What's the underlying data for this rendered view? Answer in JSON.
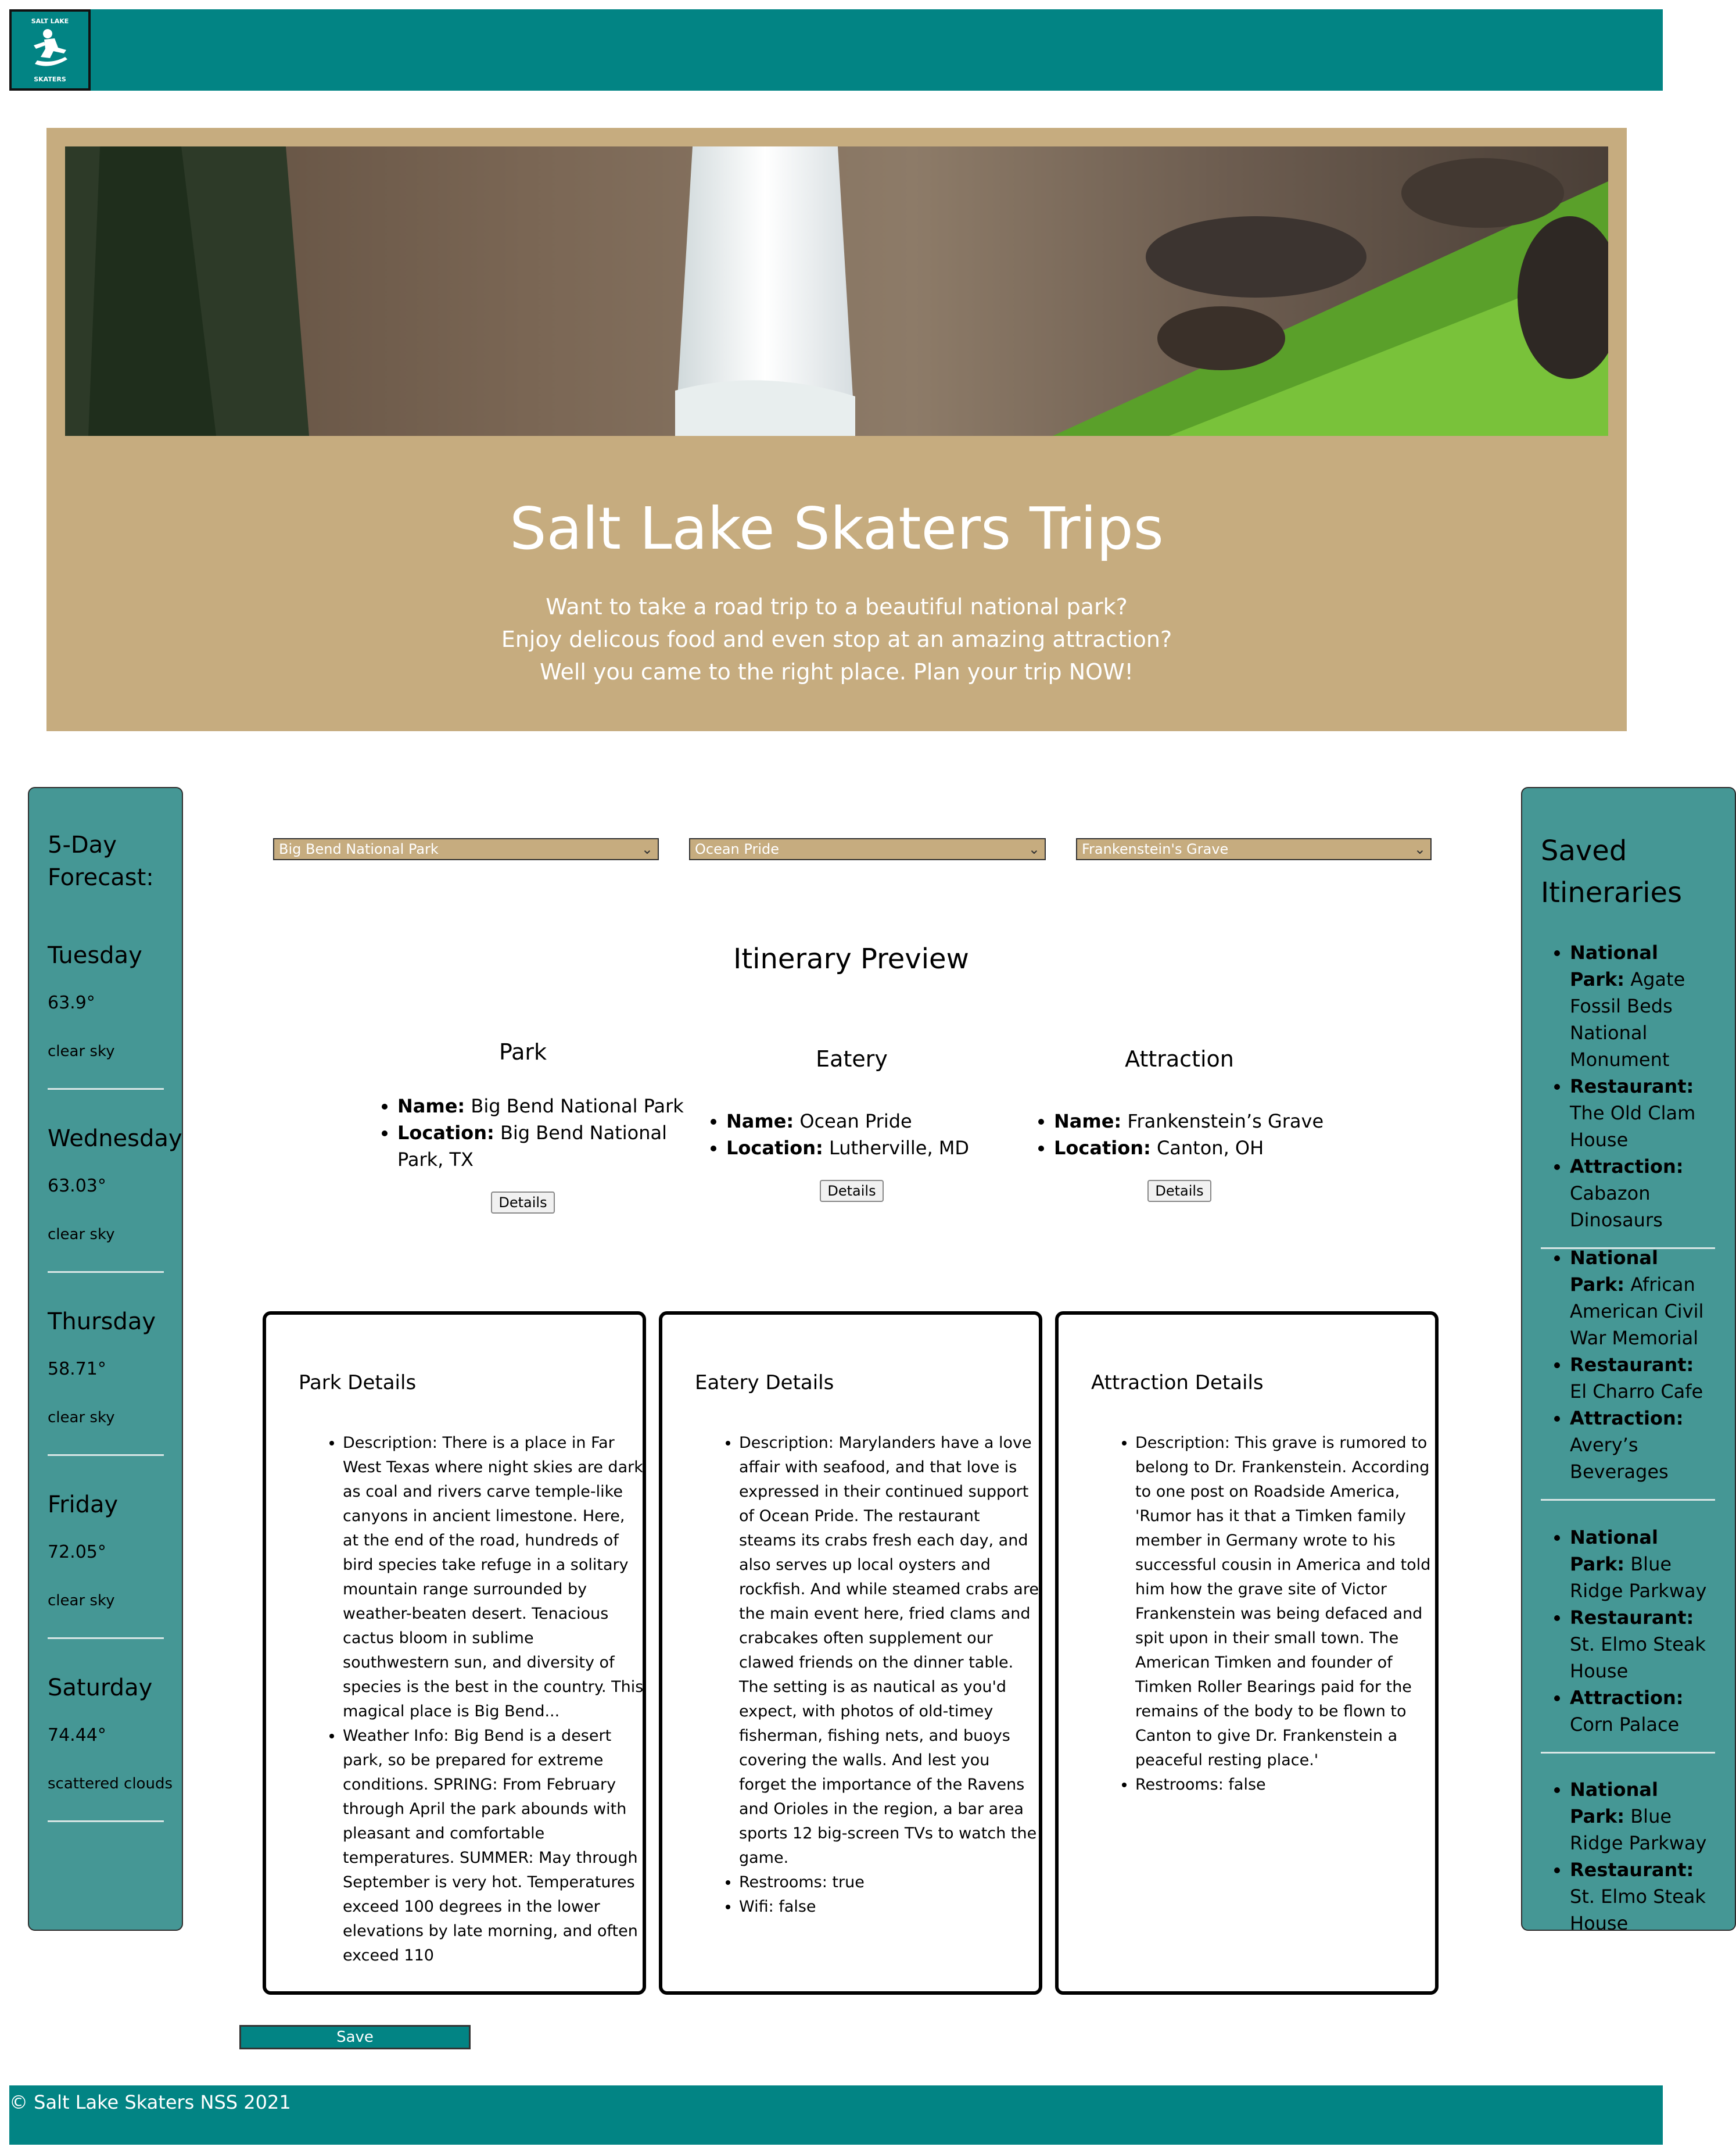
{
  "colors": {
    "header": "#028484",
    "hero_bg": "#c6ac7f",
    "sidebar": "#459795"
  },
  "logo": {
    "text_top": "SALT LAKE",
    "text_bottom": "SKATERS"
  },
  "hero": {
    "title": "Salt Lake Skaters Trips",
    "lines": [
      "Want to take a road trip to a beautiful national park?",
      "Enjoy delicous food and even stop at an amazing attraction?",
      "Well you came to the right place. Plan your trip NOW!"
    ]
  },
  "forecast": {
    "title_line1": "5-Day",
    "title_line2": "Forecast:",
    "days": [
      {
        "name": "Tuesday",
        "temp": "63.9°",
        "desc": "clear sky"
      },
      {
        "name": "Wednesday",
        "temp": "63.03°",
        "desc": "clear sky"
      },
      {
        "name": "Thursday",
        "temp": "58.71°",
        "desc": "clear sky"
      },
      {
        "name": "Friday",
        "temp": "72.05°",
        "desc": "clear sky"
      },
      {
        "name": "Saturday",
        "temp": "74.44°",
        "desc": "scattered clouds"
      }
    ]
  },
  "selects": {
    "park": "Big Bend National Park",
    "eatery": "Ocean Pride",
    "attraction": "Frankenstein's Grave"
  },
  "preview": {
    "title": "Itinerary Preview",
    "labels": {
      "name": "Name:",
      "location": "Location:"
    },
    "details_button": "Details",
    "park": {
      "heading": "Park",
      "name": "Big Bend National Park",
      "location": "Big Bend National Park, TX"
    },
    "eatery": {
      "heading": "Eatery",
      "name": "Ocean Pride",
      "location": "Lutherville, MD"
    },
    "attraction": {
      "heading": "Attraction",
      "name": "Frankenstein’s Grave",
      "location": "Canton, OH"
    }
  },
  "details": {
    "labels": {
      "description": "Description:",
      "weather": "Weather Info:",
      "restrooms": "Restrooms:",
      "wifi": "Wifi:"
    },
    "park": {
      "heading": "Park Details",
      "description": "There is a place in Far West Texas where night skies are dark as coal and rivers carve temple-like canyons in ancient limestone. Here, at the end of the road, hundreds of bird species take refuge in a solitary mountain range surrounded by weather-beaten desert. Tenacious cactus bloom in sublime southwestern sun, and diversity of species is the best in the country. This magical place is Big Bend...",
      "weather": "Big Bend is a desert park, so be prepared for extreme conditions. SPRING: From February through April the park abounds with pleasant and comfortable temperatures. SUMMER: May through September is very hot. Temperatures exceed 100 degrees in the lower elevations by late morning, and often exceed 110"
    },
    "eatery": {
      "heading": "Eatery Details",
      "description": "Marylanders have a love affair with seafood, and that love is expressed in their continued support of Ocean Pride. The restaurant steams its crabs fresh each day, and also serves up local oysters and rockfish. And while steamed crabs are the main event here, fried clams and crabcakes often supplement our clawed friends on the dinner table. The setting is as nautical as you'd expect, with photos of old-timey fisherman, fishing nets, and buoys covering the walls. And lest you forget the importance of the Ravens and Orioles in the region, a bar area sports 12 big-screen TVs to watch the game.",
      "restrooms": "true",
      "wifi": "false"
    },
    "attraction": {
      "heading": "Attraction Details",
      "description": "This grave is rumored to belong to Dr. Frankenstein. According to one post on Roadside America, 'Rumor has it that a Timken family member in Germany wrote to his successful cousin in America and told him how the grave site of Victor Frankenstein was being defaced and spit upon in their small town. The American Timken and founder of Timken Roller Bearings paid for the remains of the body to be flown to Canton to give Dr. Frankenstein a peaceful resting place.'",
      "restrooms": "false"
    }
  },
  "save_button": "Save",
  "saved": {
    "title_line1": "Saved",
    "title_line2": "Itineraries",
    "labels": {
      "park": "National Park:",
      "restaurant": "Restaurant:",
      "attraction": "Attraction:"
    },
    "items": [
      {
        "park": "Agate Fossil Beds National Monument",
        "restaurant": "The Old Clam House",
        "attraction": "Cabazon Dinosaurs"
      },
      {
        "park": "African American Civil War Memorial",
        "restaurant": "El Charro Cafe",
        "attraction": "Avery’s Beverages"
      },
      {
        "park": "Blue Ridge Parkway",
        "restaurant": "St. Elmo Steak House",
        "attraction": "Corn Palace"
      },
      {
        "park": "Blue Ridge Parkway",
        "restaurant": "St. Elmo Steak House",
        "attraction": ""
      }
    ]
  },
  "footer": "© Salt Lake Skaters NSS 2021"
}
